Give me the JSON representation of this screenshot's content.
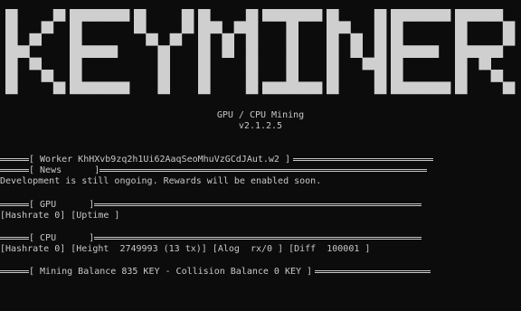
{
  "logo": {
    "text": "KEYMINER",
    "color": "#cfcfcf"
  },
  "banner": {
    "subtitle": "GPU / CPU Mining",
    "version": "v2.1.2.5"
  },
  "worker": {
    "text": "[ Worker KhHXvb9zq2h1Ui62AaqSeoMhuVzGCdJAut.w2 ]"
  },
  "news": {
    "header": "[ News      ]",
    "message": "Development is still ongoing. Rewards will be enabled soon."
  },
  "gpu": {
    "header": "[ GPU      ]",
    "stats": "[Hashrate 0] [Uptime ]"
  },
  "cpu": {
    "header": "[ CPU      ]",
    "stats": "[Hashrate 0] [Height  2749993 (13 tx)] [Alog  rx/0 ] [Diff  100001 ]"
  },
  "balance": {
    "text": "[ Mining Balance 835 KEY - Collision Balance 0 KEY ]"
  }
}
